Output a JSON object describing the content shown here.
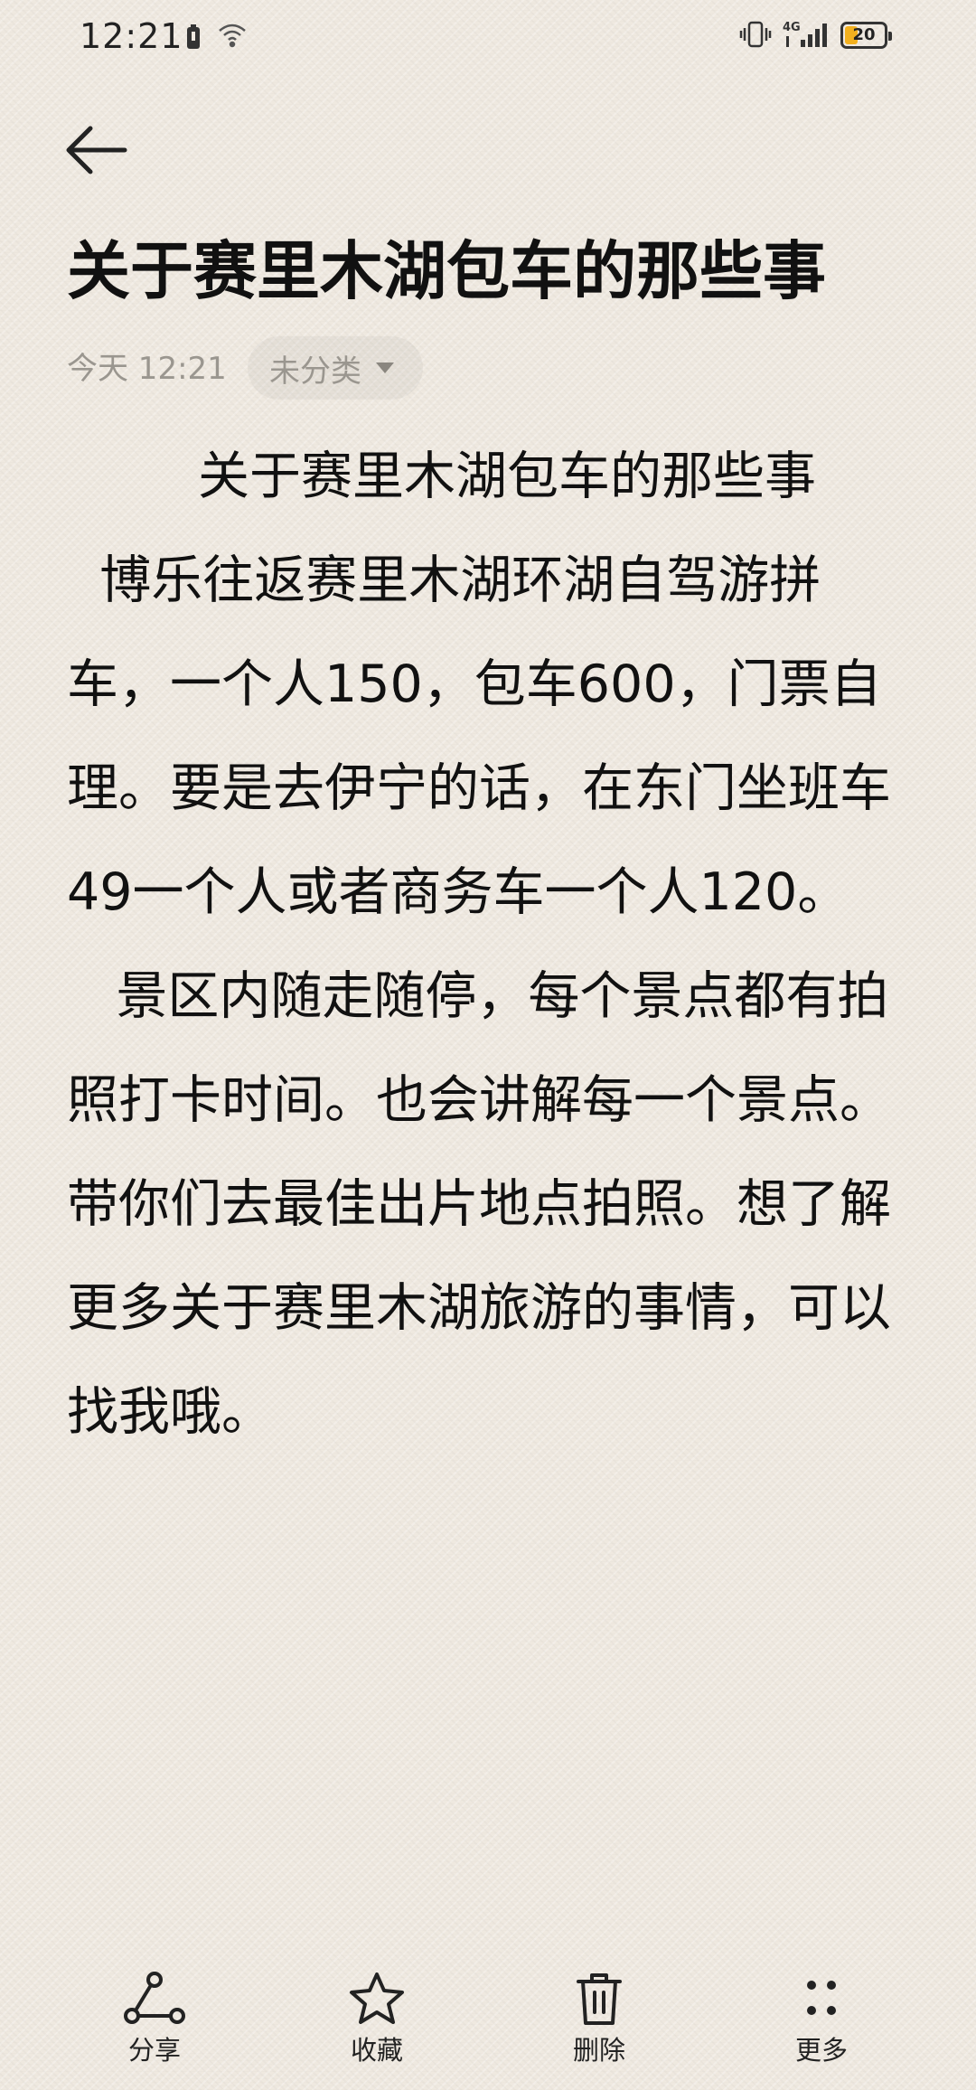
{
  "status_bar": {
    "time": "12:21",
    "battery_level": "20",
    "battery_fraction": 0.2,
    "battery_color": "#f2b01e",
    "network_label": "4G"
  },
  "note": {
    "title": "关于赛里木湖包车的那些事",
    "date": "今天 12:21",
    "category": "未分类",
    "paragraphs": [
      "        关于赛里木湖包车的那些事",
      "  博乐往返赛里木湖环湖自驾游拼车，一个人150，包车600，门票自理。要是去伊宁的话，在东门坐班车49一个人或者商务车一个人120。",
      "   景区内随走随停，每个景点都有拍照打卡时间。也会讲解每一个景点。带你们去最佳出片地点拍照。想了解更多关于赛里木湖旅游的事情，可以找我哦。"
    ]
  },
  "toolbar": {
    "share_label": "分享",
    "favorite_label": "收藏",
    "delete_label": "删除",
    "more_label": "更多"
  },
  "icons": {
    "back": "arrow-left-icon",
    "share": "share-icon",
    "favorite": "star-icon",
    "delete": "trash-icon",
    "more": "dots-grid-icon"
  }
}
